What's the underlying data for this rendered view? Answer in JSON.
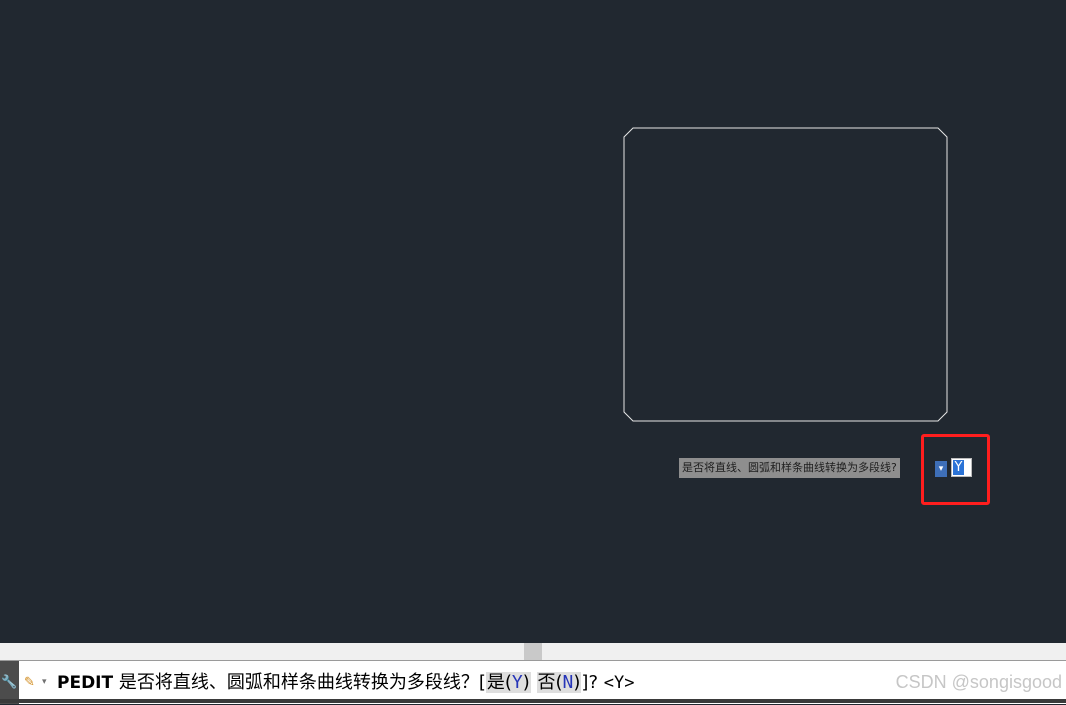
{
  "dynamic_input": {
    "prompt": "是否将直线、圆弧和样条曲线转换为多段线?",
    "arrow_icon": "down-arrow-icon",
    "value": "Y"
  },
  "command_line": {
    "wrench_icon": "wrench-icon",
    "pencil_icon": "pencil-icon",
    "command": "PEDIT",
    "question": "是否将直线、圆弧和样条曲线转换为多段线？[",
    "option_yes_label": "是(",
    "option_yes_key": "Y",
    "option_no_label": "否(",
    "option_no_key": "N",
    "close_paren": ")",
    "suffix": "]?",
    "default": "<Y>"
  },
  "watermark": "CSDN @songisgood",
  "colors": {
    "canvas": "#212830",
    "highlight": "#ff1e1e",
    "option_key": "#2534b8"
  }
}
